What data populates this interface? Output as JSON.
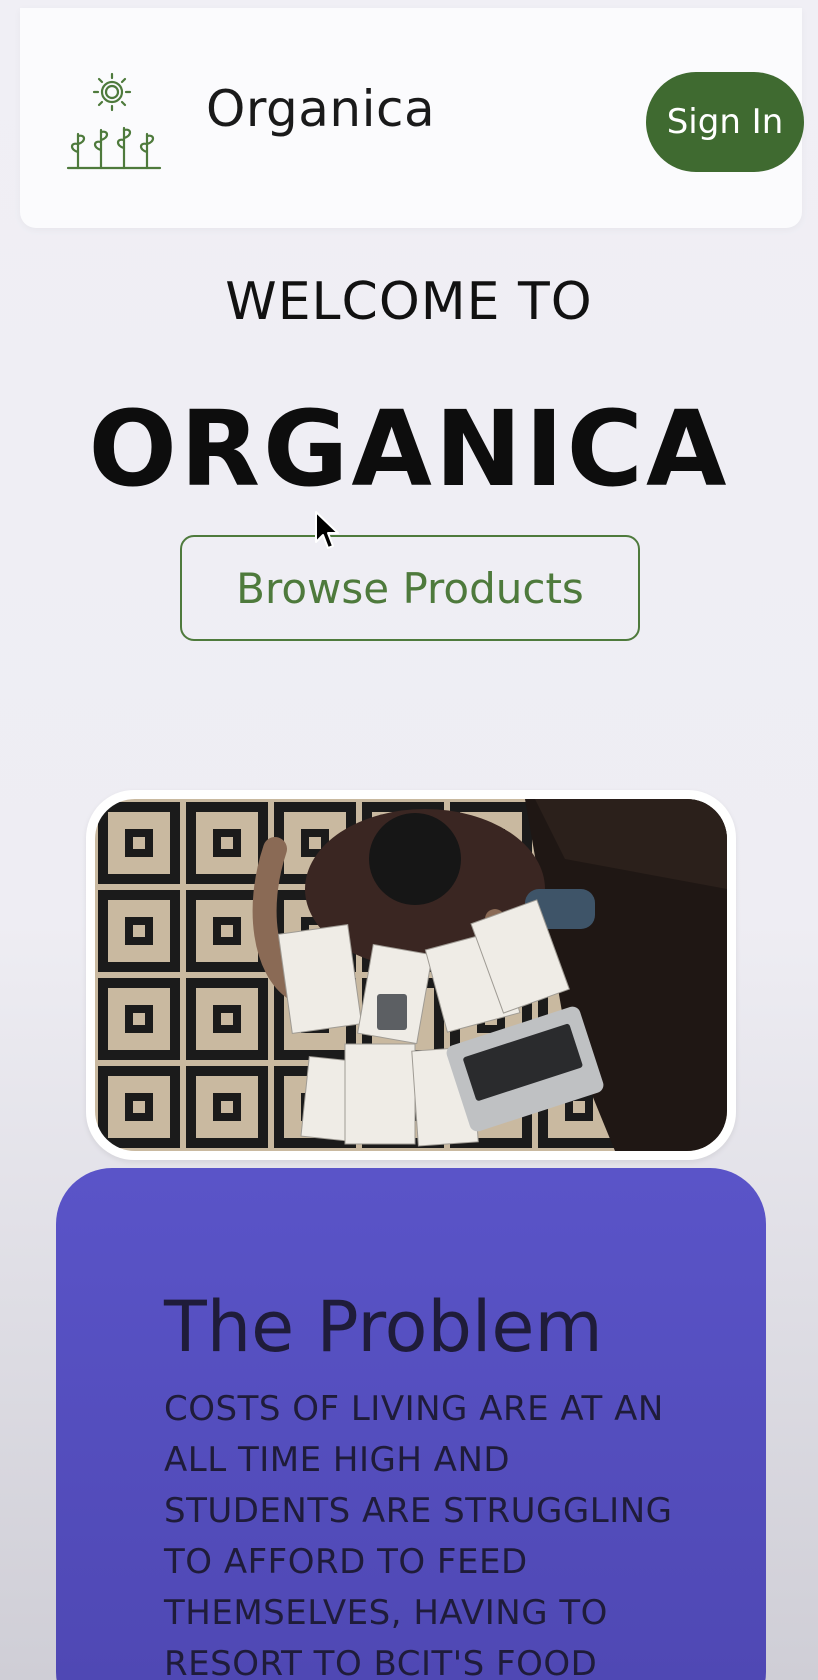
{
  "header": {
    "brand": "Organica",
    "sign_in_label": "Sign In",
    "logo_icon": "sun-and-sprouts-icon"
  },
  "hero": {
    "welcome": "WELCOME TO",
    "title": "ORGANICA",
    "browse_label": "Browse Products"
  },
  "problem": {
    "title": "The Problem",
    "text": "Costs of living are at an all time high and students are struggling to afford to feed themselves, having to resort to BCIT's food"
  },
  "colors": {
    "accent_green": "#3f6a30",
    "problem_card": "#5a54c8"
  }
}
